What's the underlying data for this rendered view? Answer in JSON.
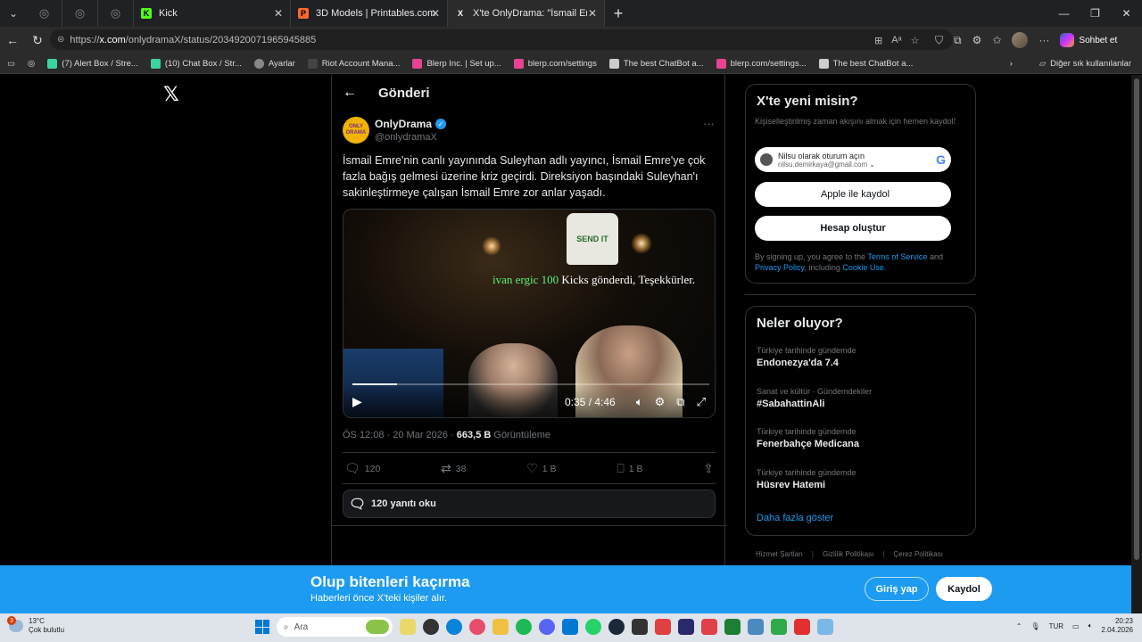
{
  "browser": {
    "tabs": [
      {
        "label": "Kick",
        "fav_color": "#53fc18",
        "fav_letter": "K"
      },
      {
        "label": "3D Models | Printables.com",
        "fav_color": "#fa6831",
        "fav_letter": "P"
      },
      {
        "label": "X'te OnlyDrama: \"İsmail Emre'nin",
        "fav_color": "#ffffff",
        "fav_letter": "X"
      }
    ],
    "url_host": "x.com",
    "url_prefix": "https://",
    "url_path": "/onlydramaX/status/2034920071965945885",
    "sohbet_label": "Sohbet et",
    "bookmarks": [
      {
        "label": "(7) Alert Box / Stre...",
        "color": "#3ad3a2"
      },
      {
        "label": "(10) Chat Box / Str...",
        "color": "#3ad3a2"
      },
      {
        "label": "Ayarlar",
        "color": "#888888"
      },
      {
        "label": "Riot Account Mana...",
        "color": "#222222"
      },
      {
        "label": "Blerp Inc. | Set up...",
        "color": "#e84393"
      },
      {
        "label": "blerp.com/settings",
        "color": "#e84393"
      },
      {
        "label": "The best ChatBot a...",
        "color": "#cccccc"
      },
      {
        "label": "blerp.com/settings...",
        "color": "#e84393"
      },
      {
        "label": "The best ChatBot a...",
        "color": "#cccccc"
      }
    ],
    "other_bookmarks": "Diğer sık kullanılanlar"
  },
  "header": {
    "title": "Gönderi"
  },
  "tweet": {
    "author_name": "OnlyDrama",
    "author_handle": "@onlydramaX",
    "avatar_text": "ONLY DRAMA",
    "text": "İsmail Emre'nin canlı yayınında Suleyhan adlı yayıncı, İsmail Emre'ye çok fazla bağış gelmesi üzerine kriz geçirdi. Direksiyon başındaki Suleyhan'ı sakinleştirmeye çalışan İsmail Emre zor anlar yaşadı.",
    "video": {
      "overlay_user": "ivan",
      "overlay_user2": "ergic 100",
      "overlay_rest": " Kicks gönderdi, Teşekkürler.",
      "tshirt_text": "SEND IT",
      "time": "0:35 / 4:46",
      "progress": 0.125
    },
    "timestamp": "ÖS 12:08 · 20 Mar 2026 · ",
    "views": "663,5 B",
    "views_label": " Görüntüleme",
    "replies": "120",
    "reposts": "38",
    "likes": "1 B",
    "bookmarks": "1 B",
    "read_replies": "120 yanıtı oku"
  },
  "signup_card": {
    "title": "X'te yeni misin?",
    "subtitle": "Kişiselleştirilmiş zaman akışını almak için hemen kaydol!",
    "google_line1": "Nilsu olarak oturum açın",
    "google_line2": "nilsu.demirkaya@gmail.com",
    "apple_label": "Apple ile kaydol",
    "create_label": "Hesap oluştur",
    "legal_prefix": "By signing up, you agree to the ",
    "terms": "Terms of Service",
    "and": " and ",
    "privacy": "Privacy Policy",
    "including": ", including ",
    "cookie": "Cookie Use",
    "period": "."
  },
  "trends": {
    "title": "Neler oluyor?",
    "items": [
      {
        "context": "Türkiye tarihinde gündemde",
        "name": "Endonezya'da 7.4"
      },
      {
        "context": "Sanat ve kültür · Gündemdekiler",
        "name": "#SabahattinAli"
      },
      {
        "context": "Türkiye tarihinde gündemde",
        "name": "Fenerbahçe Medicana"
      },
      {
        "context": "Türkiye tarihinde gündemde",
        "name": "Hüsrev Hatemi"
      }
    ],
    "show_more": "Daha fazla göster"
  },
  "footer_links": [
    "Hizmet Şartları",
    "Gizlilik Politikası",
    "Çerez Politikası"
  ],
  "banner": {
    "title": "Olup bitenleri kaçırma",
    "subtitle": "Haberleri önce X'teki kişiler alır.",
    "login": "Giriş yap",
    "signup": "Kaydol"
  },
  "taskbar": {
    "temp": "13°C",
    "weather": "Çok bulutlu",
    "badge": "3",
    "search": "Ara",
    "lang": "TUR",
    "time": "20:23",
    "date": "2.04.2026"
  }
}
